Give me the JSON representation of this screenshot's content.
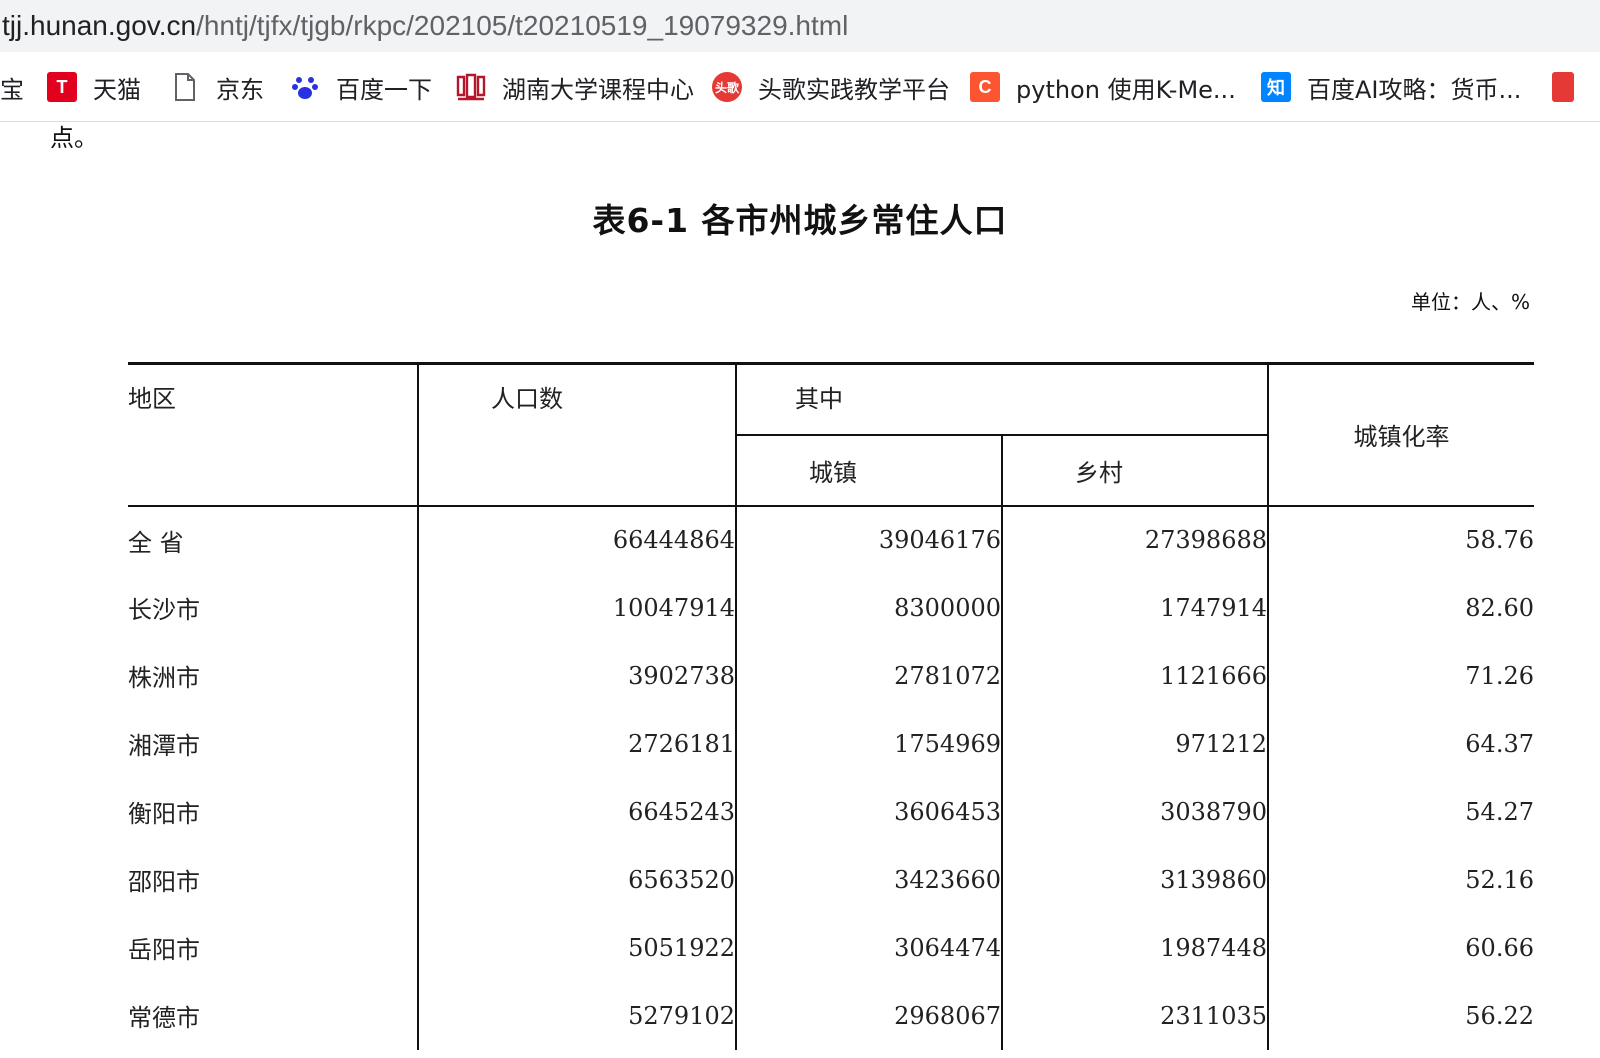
{
  "browser": {
    "url_host": "tjj.hunan.gov.cn",
    "url_path": "/hntj/tjfx/tjgb/rkpc/202105/t20210519_19079329.html",
    "bookmarks": [
      {
        "label": "宝",
        "icon": "partial-bookmark-icon"
      },
      {
        "label": "天猫",
        "icon": "tmall-icon",
        "glyph": "T",
        "color": "#e1001e"
      },
      {
        "label": "京东",
        "icon": "page-icon"
      },
      {
        "label": "百度一下",
        "icon": "baidu-paw-icon",
        "color": "#2932e1"
      },
      {
        "label": "湖南大学课程中心",
        "icon": "hnu-logo-icon",
        "color": "#b5162b"
      },
      {
        "label": "头歌实践教学平台",
        "icon": "touge-icon",
        "glyph": "头歌",
        "color": "#e53935"
      },
      {
        "label": "python 使用K-Me...",
        "icon": "csdn-icon",
        "glyph": "C",
        "color": "#fc5531"
      },
      {
        "label": "百度AI攻略：货币...",
        "icon": "zhihu-icon",
        "glyph": "知",
        "color": "#0084ff"
      }
    ]
  },
  "page": {
    "intro_text": "点。",
    "title": "表6-1 各市州城乡常住人口",
    "unit": "单位：人、%"
  },
  "table": {
    "headers": {
      "region": "地区",
      "population": "人口数",
      "of_which": "其中",
      "urban": "城镇",
      "rural": "乡村",
      "urbanization_rate": "城镇化率"
    },
    "rows": [
      {
        "region": "全 省",
        "population": "66444864",
        "urban": "39046176",
        "rural": "27398688",
        "rate": "58.76"
      },
      {
        "region": "长沙市",
        "population": "10047914",
        "urban": "8300000",
        "rural": "1747914",
        "rate": "82.60"
      },
      {
        "region": "株洲市",
        "population": "3902738",
        "urban": "2781072",
        "rural": "1121666",
        "rate": "71.26"
      },
      {
        "region": "湘潭市",
        "population": "2726181",
        "urban": "1754969",
        "rural": "971212",
        "rate": "64.37"
      },
      {
        "region": "衡阳市",
        "population": "6645243",
        "urban": "3606453",
        "rural": "3038790",
        "rate": "54.27"
      },
      {
        "region": "邵阳市",
        "population": "6563520",
        "urban": "3423660",
        "rural": "3139860",
        "rate": "52.16"
      },
      {
        "region": "岳阳市",
        "population": "5051922",
        "urban": "3064474",
        "rural": "1987448",
        "rate": "60.66"
      },
      {
        "region": "常德市",
        "population": "5279102",
        "urban": "2968067",
        "rural": "2311035",
        "rate": "56.22"
      }
    ]
  }
}
